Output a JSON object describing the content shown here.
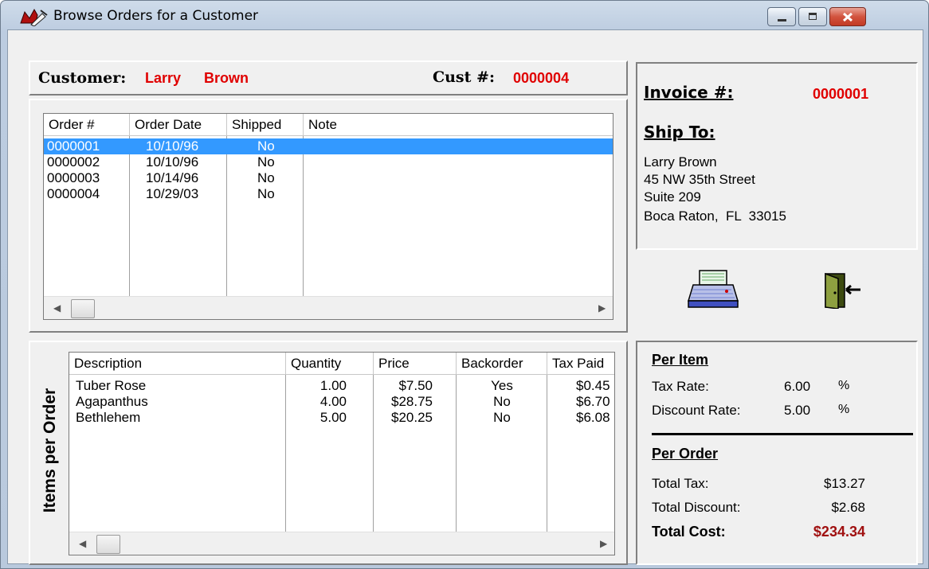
{
  "window": {
    "title": "Browse Orders for a Customer"
  },
  "customer": {
    "label": "Customer:",
    "first": "Larry",
    "last": "Brown",
    "cust_label": "Cust #:",
    "cust_num": "0000004"
  },
  "orders": {
    "columns": [
      "Order #",
      "Order Date",
      "Shipped",
      "Note"
    ],
    "rows": [
      [
        "0000001",
        "10/10/96",
        "No",
        ""
      ],
      [
        "0000002",
        "10/10/96",
        "No",
        ""
      ],
      [
        "0000003",
        "10/14/96",
        "No",
        ""
      ],
      [
        "0000004",
        "10/29/03",
        "No",
        ""
      ]
    ],
    "selected_index": 0
  },
  "items": {
    "side_label": "Items per Order",
    "columns": [
      "Description",
      "Quantity",
      "Price",
      "Backorder",
      "Tax Paid"
    ],
    "rows": [
      [
        "Tuber Rose",
        "1.00",
        "$7.50",
        "Yes",
        "$0.45"
      ],
      [
        "Agapanthus",
        "4.00",
        "$28.75",
        "No",
        "$6.70"
      ],
      [
        "Bethlehem",
        "5.00",
        "$20.25",
        "No",
        "$6.08"
      ]
    ]
  },
  "invoice": {
    "label": "Invoice #:",
    "number": "0000001",
    "ship_to_label": "Ship To:",
    "address": [
      "Larry Brown",
      "45 NW 35th Street",
      "Suite 209",
      "Boca Raton,  FL  33015"
    ]
  },
  "toolbar": {
    "print_icon": "printer-icon",
    "exit_icon": "exit-door-icon"
  },
  "totals": {
    "per_item_label": "Per Item",
    "tax_rate_label": "Tax Rate:",
    "tax_rate": "6.00",
    "tax_rate_unit": "%",
    "discount_rate_label": "Discount Rate:",
    "discount_rate": "5.00",
    "discount_rate_unit": "%",
    "per_order_label": "Per Order",
    "total_tax_label": "Total Tax:",
    "total_tax": "$13.27",
    "total_discount_label": "Total Discount:",
    "total_discount": "$2.68",
    "total_cost_label": "Total Cost:",
    "total_cost": "$234.34"
  },
  "colors": {
    "selection": "#3399ff",
    "accent_red": "#e00000",
    "total_red": "#a01010"
  }
}
